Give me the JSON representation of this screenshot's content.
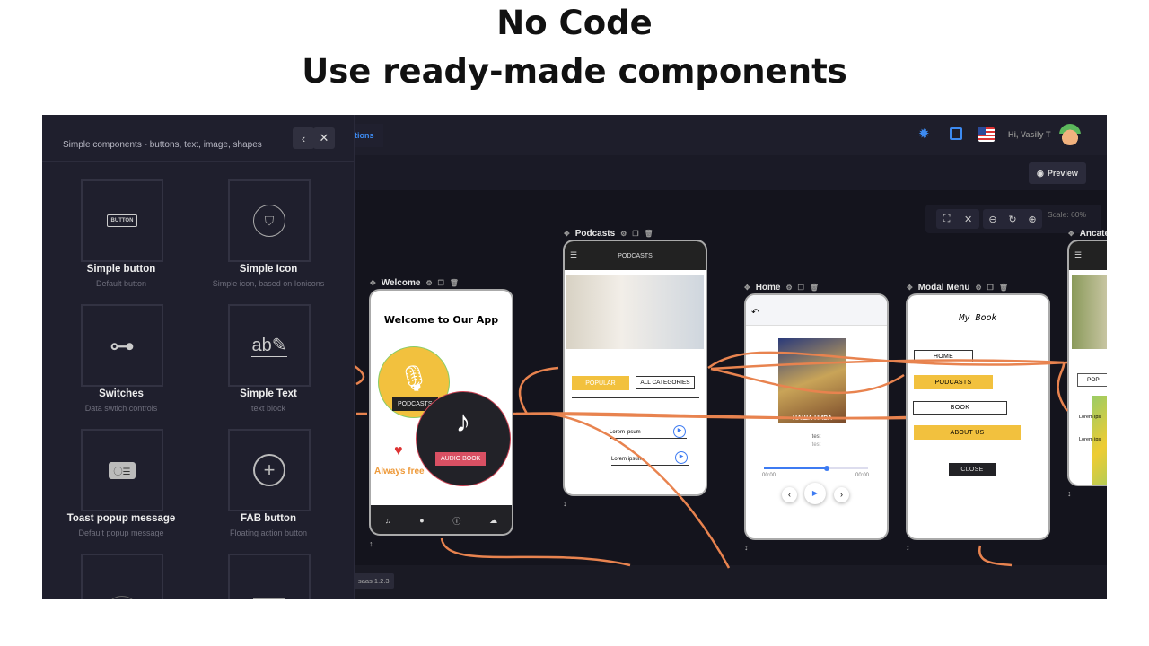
{
  "heading": {
    "line1": "No Code",
    "line2": "Use ready-made components"
  },
  "panel": {
    "subtitle": "Simple components - buttons, text, image, shapes",
    "back_icon": "chevron-left-icon",
    "close_icon": "close-icon",
    "items": [
      {
        "name": "Simple button",
        "desc": "Default button",
        "preview": "BUTTON"
      },
      {
        "name": "Simple Icon",
        "desc": "Simple icon, based on Ionicons"
      },
      {
        "name": "Switches",
        "desc": "Data swtich controls"
      },
      {
        "name": "Simple Text",
        "desc": "text block"
      },
      {
        "name": "Toast popup message",
        "desc": "Default popup message"
      },
      {
        "name": "FAB button",
        "desc": "Floating action button"
      }
    ]
  },
  "topbar": {
    "tab_partial": "tions",
    "greeting": "Hi, Vasily T"
  },
  "toolbar": {
    "preview": "Preview"
  },
  "zoom": {
    "scale": "Scale: 60%"
  },
  "footer": {
    "version": "saas 1.2.3"
  },
  "accent": "#e8834f",
  "screens": {
    "welcome": {
      "label": "Welcome",
      "title": "Welcome to Our App",
      "podcasts": "PODCASTS",
      "audiobook": "AUDIO BOOK",
      "free": "Always free"
    },
    "podcasts": {
      "label": "Podcasts",
      "header": "PODCASTS",
      "popular": "POPULAR",
      "all": "ALL CATEGORIES",
      "items": [
        "Lorem ipsum",
        "Lorem ipsum"
      ]
    },
    "home": {
      "label": "Home",
      "track": "test",
      "artist": "test",
      "time_start": "00:00",
      "time_end": "00:00",
      "progress": 0.6,
      "cover_text": "НАША НИВА"
    },
    "modal": {
      "label": "Modal Menu",
      "title": "My Book",
      "buttons": [
        "HOME",
        "PODCASTS",
        "BOOK",
        "ABOUT US"
      ],
      "close": "CLOSE"
    },
    "categories": {
      "label": "Ancate",
      "popular": "POP",
      "items": [
        "Lorem ips",
        "Lorem ips"
      ]
    }
  }
}
